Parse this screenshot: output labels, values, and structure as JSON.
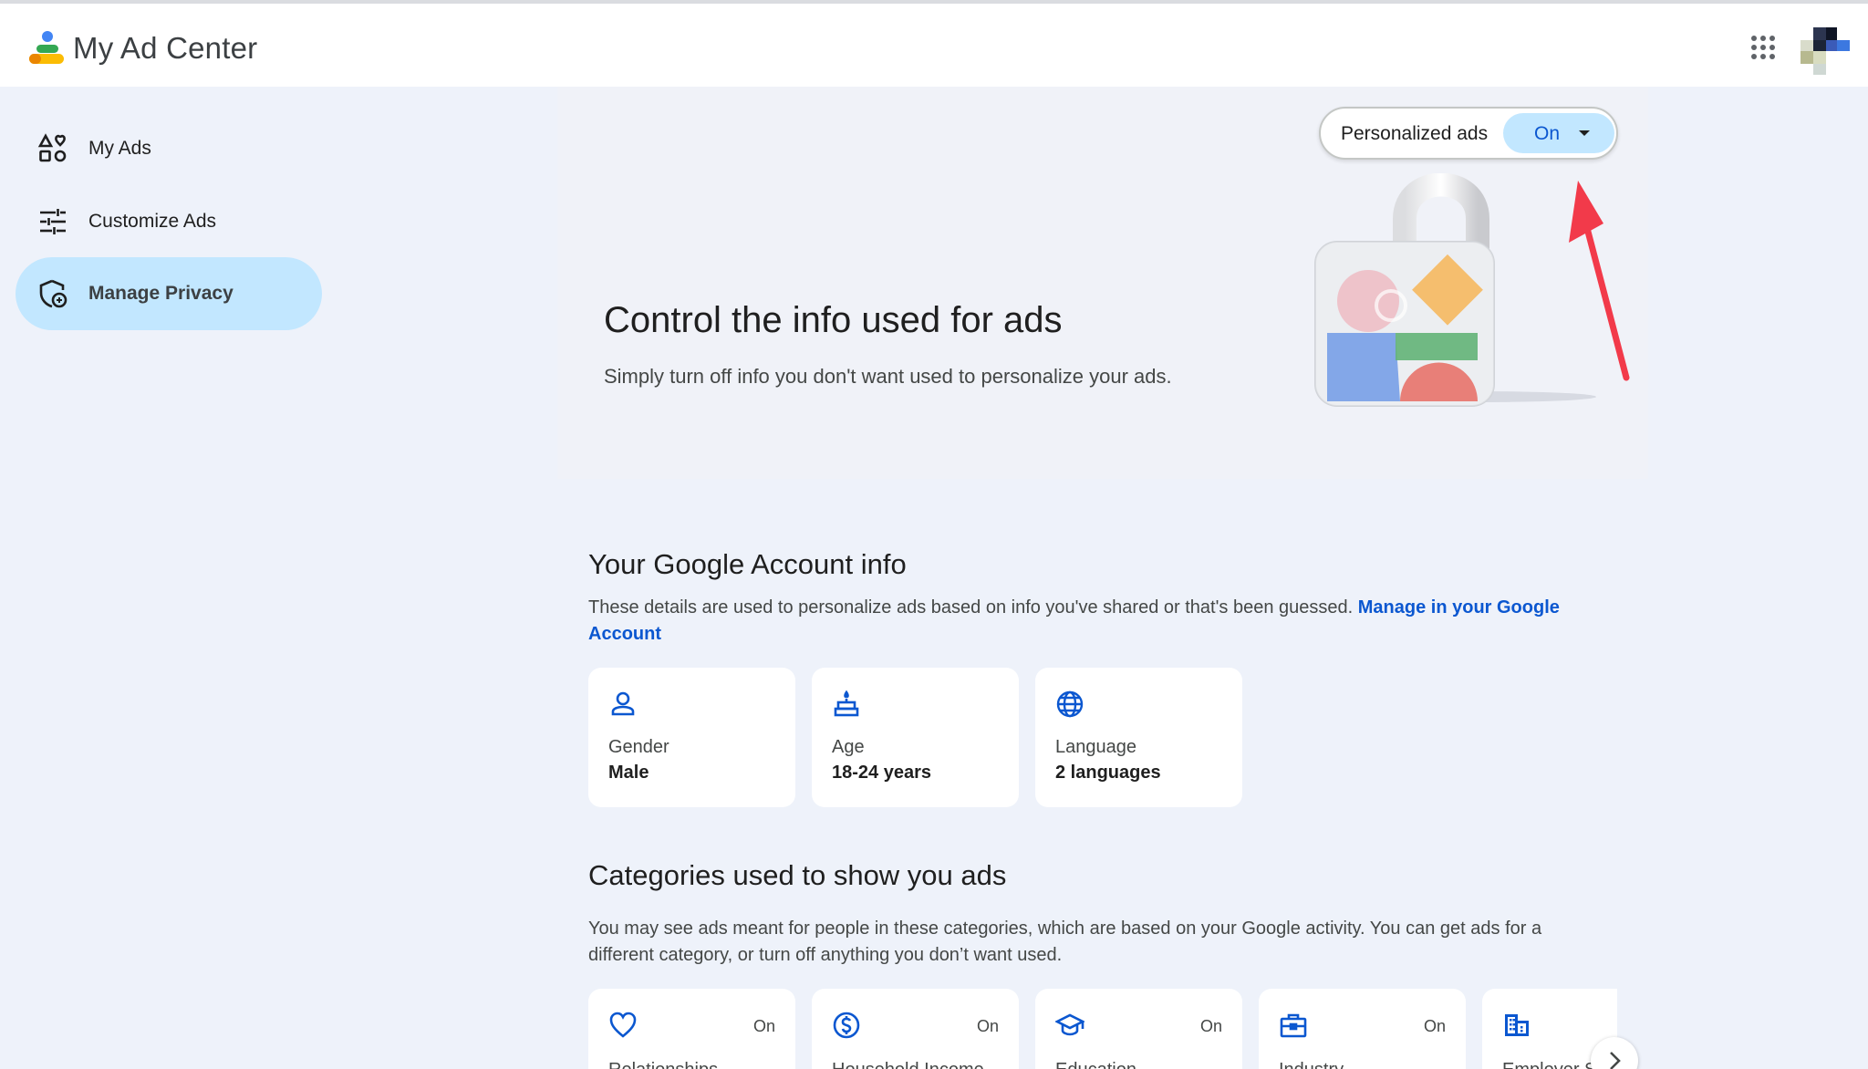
{
  "app": {
    "title": "My Ad Center"
  },
  "header": {
    "apps_icon": "apps-grid-icon",
    "avatar": "account-avatar"
  },
  "sidebar": {
    "items": [
      {
        "label": "My Ads",
        "icon": "my-ads-icon",
        "active": false
      },
      {
        "label": "Customize Ads",
        "icon": "sliders-icon",
        "active": false
      },
      {
        "label": "Manage Privacy",
        "icon": "privacy-shield-icon",
        "active": true
      }
    ]
  },
  "hero": {
    "personalized_label": "Personalized ads",
    "personalized_value": "On",
    "title": "Control the info used for ads",
    "subtitle": "Simply turn off info you don't want used to personalize your ads."
  },
  "account_info": {
    "title": "Your Google Account info",
    "description": "These details are used to personalize ads based on info you've shared or that's been guessed.",
    "link": "Manage in your Google Account",
    "cards": [
      {
        "label": "Gender",
        "value": "Male",
        "icon": "person-icon"
      },
      {
        "label": "Age",
        "value": "18-24 years",
        "icon": "cake-icon"
      },
      {
        "label": "Language",
        "value": "2 languages",
        "icon": "globe-icon"
      }
    ]
  },
  "categories": {
    "title": "Categories used to show you ads",
    "description": "You may see ads meant for people in these categories, which are based on your Google activity. You can get ads for a different category, or turn off anything you don’t want used.",
    "cards": [
      {
        "label": "Relationships",
        "state": "On",
        "icon": "heart-icon"
      },
      {
        "label": "Household Income",
        "state": "On",
        "icon": "dollar-icon"
      },
      {
        "label": "Education",
        "state": "On",
        "icon": "graduation-cap-icon"
      },
      {
        "label": "Industry",
        "state": "On",
        "icon": "briefcase-icon"
      },
      {
        "label": "Employer Size",
        "state": "",
        "icon": "building-icon"
      }
    ]
  },
  "colors": {
    "accent": "#0b57d0",
    "active_bg": "#c2e7ff",
    "page_bg": "#eef2fa",
    "arrow": "#f23a4a"
  }
}
